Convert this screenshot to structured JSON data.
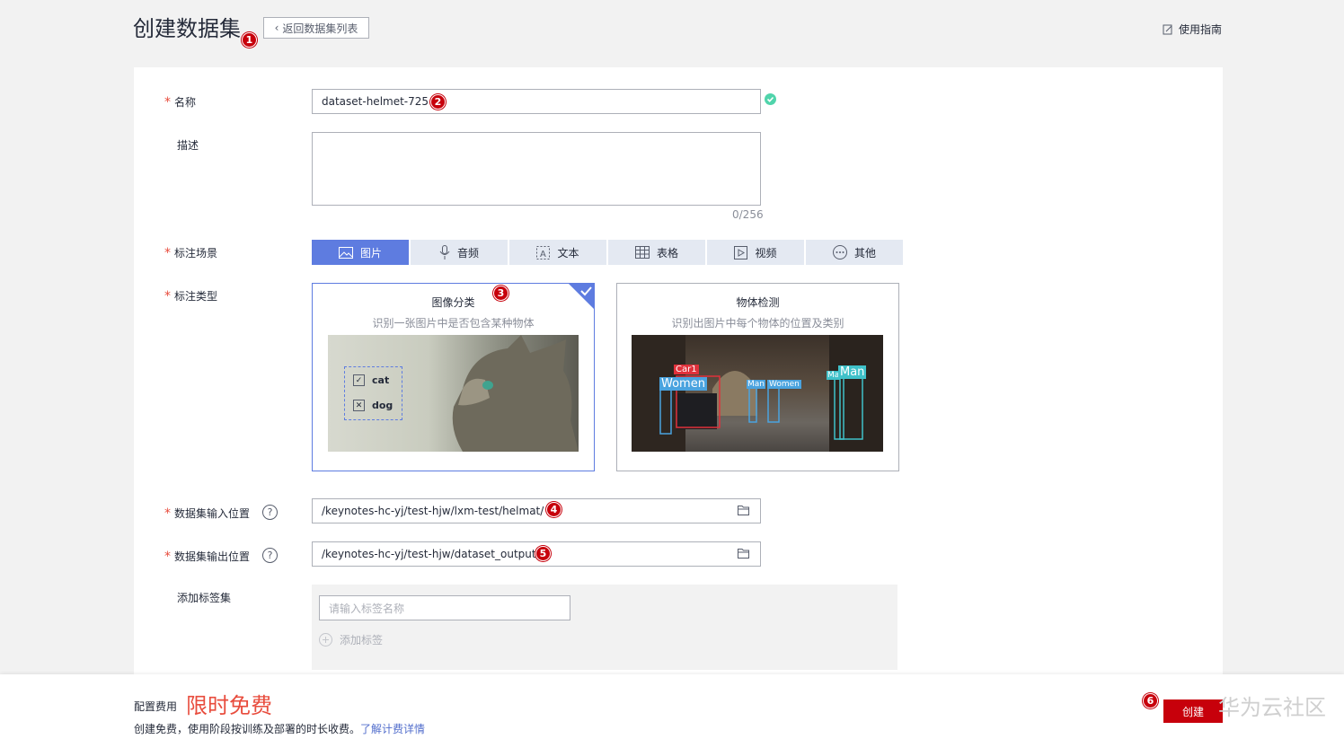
{
  "header": {
    "title": "创建数据集",
    "back_label": "返回数据集列表",
    "guide_label": "使用指南"
  },
  "markers": [
    "1",
    "2",
    "3",
    "4",
    "5",
    "6"
  ],
  "form": {
    "name_label": "名称",
    "name_value": "dataset-helmet-725",
    "desc_label": "描述",
    "desc_counter": "0/256",
    "scene_label": "标注场景",
    "scene_tabs": [
      {
        "label": "图片",
        "icon": "image-icon",
        "active": true
      },
      {
        "label": "音频",
        "icon": "microphone-icon",
        "active": false
      },
      {
        "label": "文本",
        "icon": "text-icon",
        "active": false
      },
      {
        "label": "表格",
        "icon": "table-icon",
        "active": false
      },
      {
        "label": "视频",
        "icon": "video-icon",
        "active": false
      },
      {
        "label": "其他",
        "icon": "more-icon",
        "active": false
      }
    ],
    "type_label": "标注类型",
    "types": [
      {
        "title": "图像分类",
        "desc": "识别一张图片中是否包含某种物体",
        "options": [
          "cat",
          "dog"
        ],
        "selected": true
      },
      {
        "title": "物体检测",
        "desc": "识别出图片中每个物体的位置及类别",
        "boxes": [
          "Car1",
          "Women",
          "Man",
          "Women",
          "Ma",
          "Man"
        ],
        "selected": false
      }
    ],
    "input_label": "数据集输入位置",
    "input_value": "/keynotes-hc-yj/test-hjw/lxm-test/helmat/",
    "output_label": "数据集输出位置",
    "output_value": "/keynotes-hc-yj/test-hjw/dataset_output/",
    "tagset_label": "添加标签集",
    "tag_placeholder": "请输入标签名称",
    "add_tag_label": "添加标签",
    "help_glyph": "?"
  },
  "footer": {
    "fee_label": "配置费用",
    "fee_value": "限时免费",
    "note": "创建免费，使用阶段按训练及部署的时长收费。",
    "link": "了解计费详情",
    "create_label": "创建"
  },
  "watermark": "华为云社区",
  "colors": {
    "accent": "#5e7ce0",
    "danger": "#c7000b",
    "success": "#50d4ab",
    "free": "#e84c3d"
  }
}
